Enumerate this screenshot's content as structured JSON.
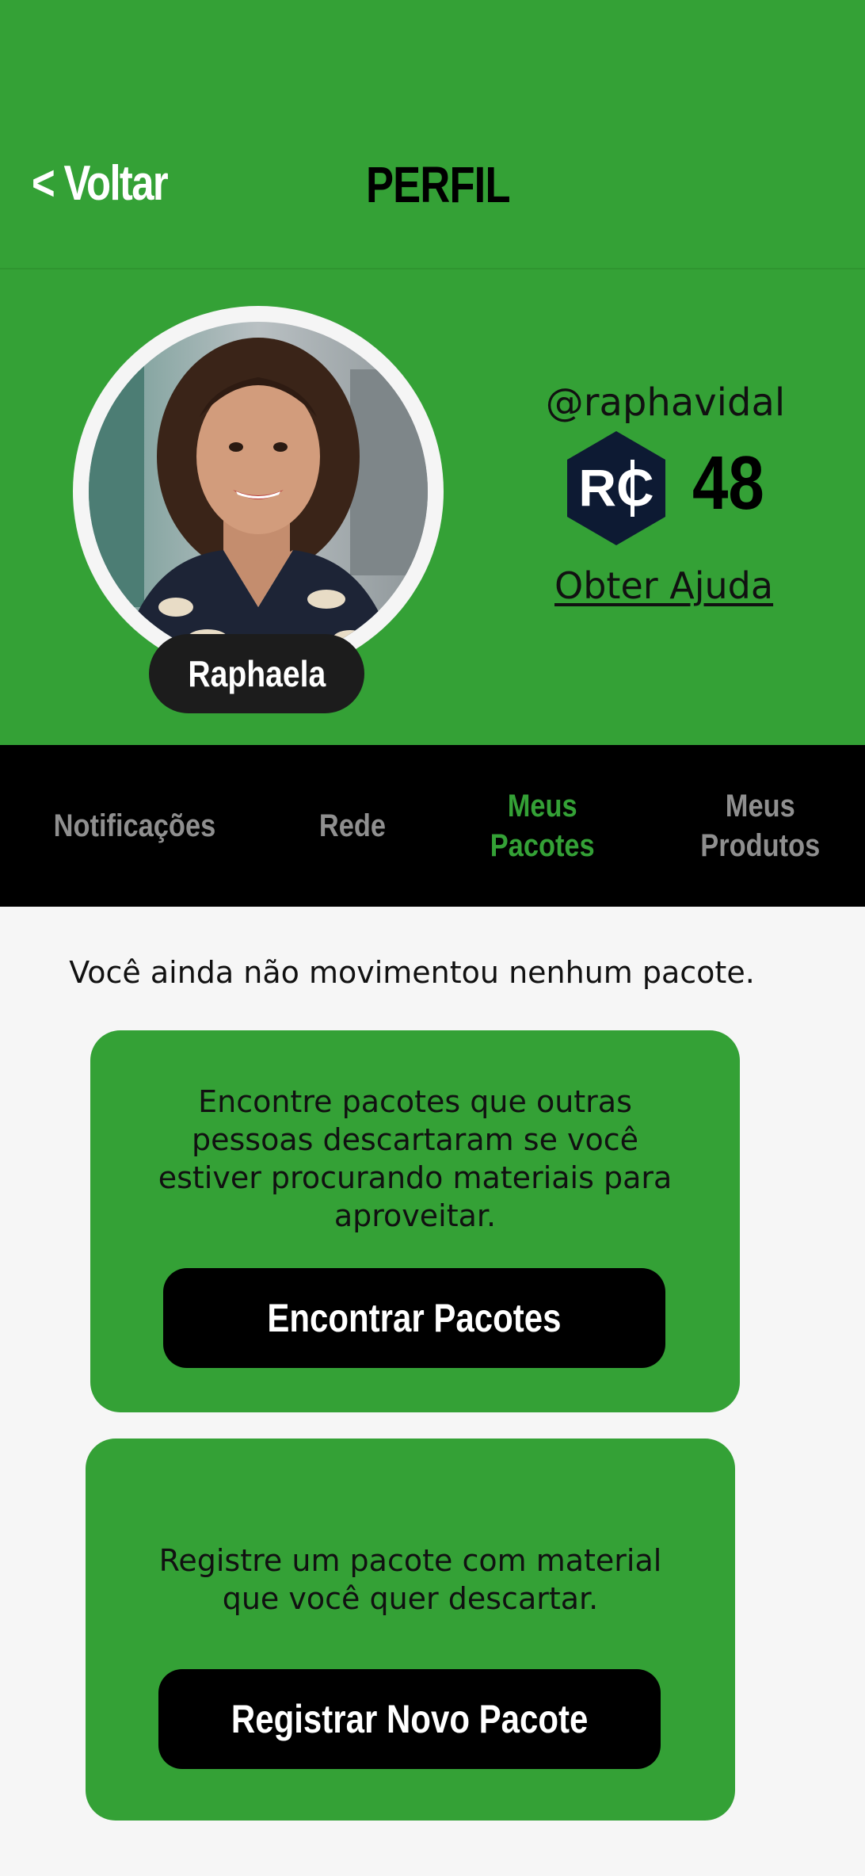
{
  "header": {
    "back_label": "< Voltar",
    "title": "PERFIL"
  },
  "profile": {
    "name": "Raphaela",
    "username": "@raphavidal",
    "coin_label": "RC",
    "coin_count": "48",
    "help_link": "Obter Ajuda"
  },
  "tabs": [
    {
      "label": "Notificações",
      "active": false
    },
    {
      "label": "Rede",
      "active": false
    },
    {
      "label": "Meus\nPacotes",
      "active": true
    },
    {
      "label": "Meus\nProdutos",
      "active": false
    }
  ],
  "packages": {
    "empty_message": "Você ainda não movimentou nenhum pacote.",
    "find_card": {
      "text": "Encontre pacotes que outras pessoas descartaram se você estiver procurando materiais para aproveitar.",
      "button": "Encontrar Pacotes"
    },
    "register_card": {
      "text": "Registre um pacote com material que você quer descartar.",
      "button": "Registrar Novo Pacote"
    }
  },
  "colors": {
    "brand_green": "#34a136",
    "tab_bar": "#000000",
    "tab_inactive": "#8f8f8f",
    "coin_badge": "#0d1a33"
  },
  "icons": {
    "coin": "rc-coin-icon",
    "avatar": "user-photo"
  }
}
